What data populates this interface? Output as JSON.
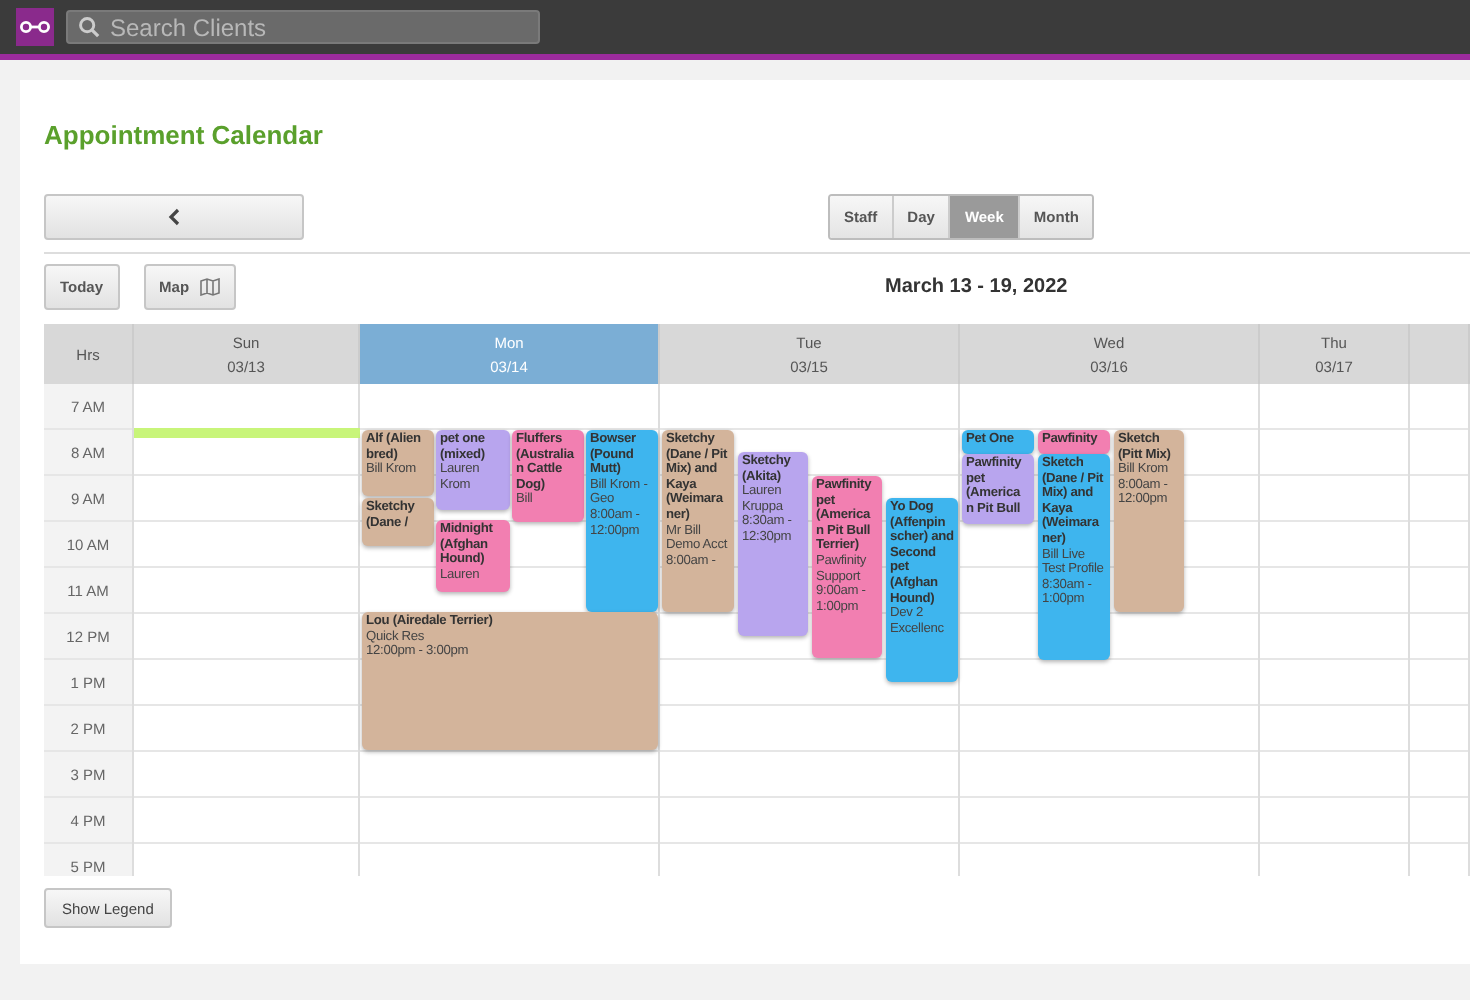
{
  "topbar": {
    "search": {
      "placeholder": "Search Clients"
    }
  },
  "page": {
    "title": "Appointment Calendar"
  },
  "views": [
    {
      "label": "Staff",
      "selected": false
    },
    {
      "label": "Day",
      "selected": false
    },
    {
      "label": "Week",
      "selected": true
    },
    {
      "label": "Month",
      "selected": false
    }
  ],
  "toolbar": {
    "today": "Today",
    "map": "Map",
    "range": "March 13 - 19, 2022"
  },
  "calendar": {
    "hours_label": "Hrs",
    "days": [
      {
        "name": "Sun",
        "date": "03/13",
        "selected": false
      },
      {
        "name": "Mon",
        "date": "03/14",
        "selected": true
      },
      {
        "name": "Tue",
        "date": "03/15",
        "selected": false
      },
      {
        "name": "Wed",
        "date": "03/16",
        "selected": false
      },
      {
        "name": "Thu",
        "date": "03/17",
        "selected": false
      }
    ],
    "hours": [
      "7 AM",
      "8 AM",
      "9 AM",
      "10 AM",
      "11 AM",
      "12 PM",
      "1 PM",
      "2 PM",
      "3 PM",
      "4 PM",
      "5 PM"
    ],
    "events": [
      {
        "title": "Alf (Alien bred)",
        "lines": [
          "Bill Krom"
        ],
        "color": "#d3b49b"
      },
      {
        "title": "Sketchy (Dane /",
        "color": "#d3b49b"
      },
      {
        "title": "pet one (mixed)",
        "lines": [
          "Lauren",
          "Krom"
        ],
        "color": "#b8a5ee"
      },
      {
        "title": "Fluffers (Australia n Cattle Dog)",
        "lines": [
          "Bill"
        ],
        "color": "#f27fb1"
      },
      {
        "title": "Midnight (Afghan Hound)",
        "lines": [
          "Lauren"
        ],
        "color": "#f27fb1"
      },
      {
        "title": "Bowser (Pound Mutt)",
        "lines": [
          "Bill Krom - Geo",
          "8:00am - 12:00pm"
        ],
        "color": "#3eb5ee"
      },
      {
        "title": "Lou (Airedale Terrier)",
        "lines": [
          "Quick Res",
          "12:00pm - 3:00pm"
        ],
        "color": "#d3b49b"
      },
      {
        "title": "Sketchy (Dane / Pit Mix) and Kaya (Weimara ner)",
        "lines": [
          "Mr Bill Demo Acct",
          "8:00am -"
        ],
        "color": "#d3b49b"
      },
      {
        "title": "Sketchy (Akita)",
        "lines": [
          "Lauren Kruppa",
          "8:30am - 12:30pm"
        ],
        "color": "#b8a5ee"
      },
      {
        "title": "Pawfinity pet (America n Pit Bull Terrier)",
        "lines": [
          "Pawfinity Support",
          "9:00am - 1:00pm"
        ],
        "color": "#f27fb1"
      },
      {
        "title": "Yo Dog (Affenpin scher) and Second pet (Afghan Hound)",
        "lines": [
          "Dev 2 Excellenc"
        ],
        "color": "#3eb5ee"
      },
      {
        "title": "Pet One",
        "color": "#3eb5ee"
      },
      {
        "title": "Pawfinity pet (America n Pit Bull",
        "color": "#b8a5ee"
      },
      {
        "title": "Pawfinity",
        "color": "#f27fb1"
      },
      {
        "title": "Sketch (Dane / Pit Mix) and Kaya (Weimara ner)",
        "lines": [
          "Bill Live Test Profile",
          "8:30am - 1:00pm"
        ],
        "color": "#3eb5ee"
      },
      {
        "title": "Sketch (Pitt Mix)",
        "lines": [
          "Bill Krom",
          "8:00am - 12:00pm"
        ],
        "color": "#d3b49b"
      }
    ]
  },
  "legend_button": "Show Legend"
}
